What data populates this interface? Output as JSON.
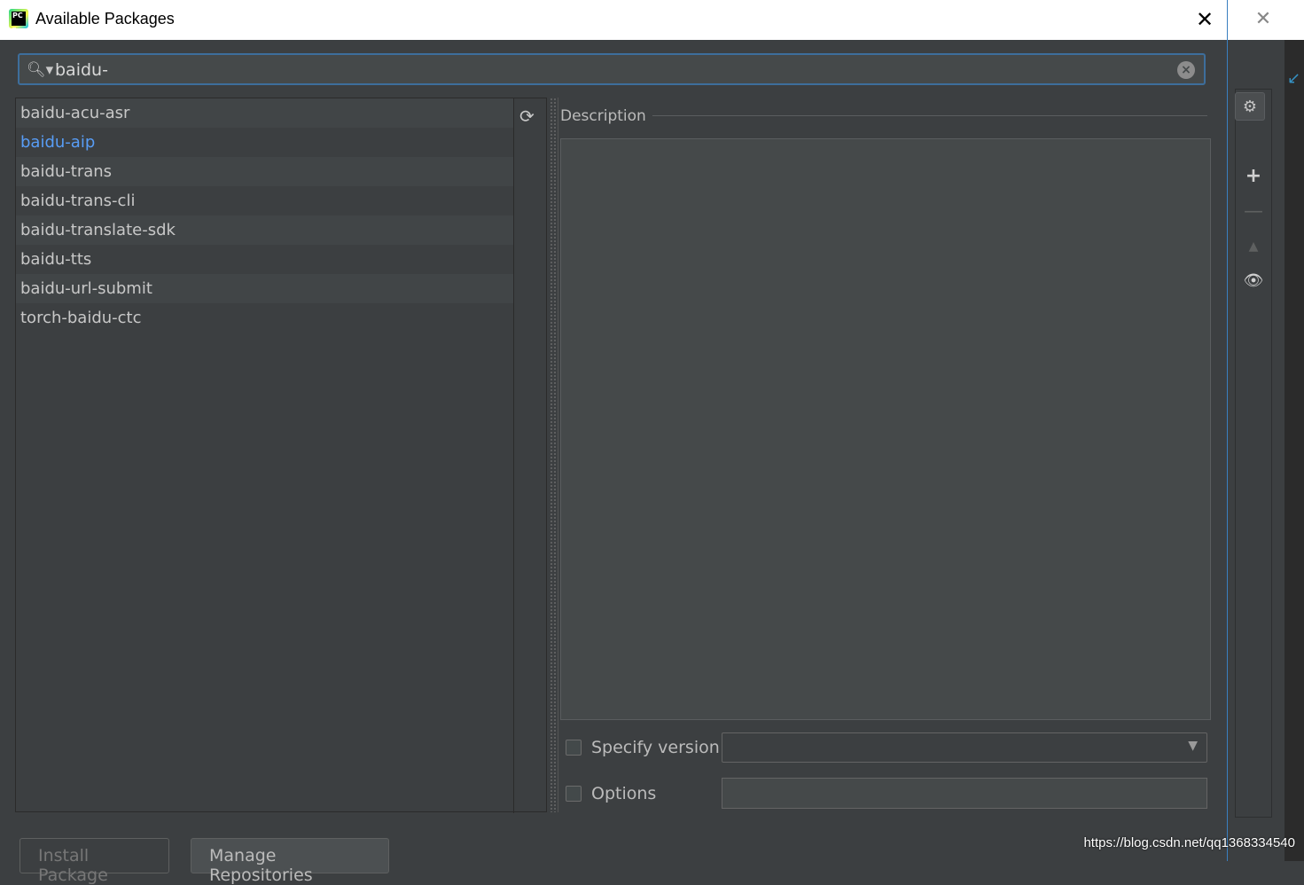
{
  "window": {
    "title": "Available Packages"
  },
  "search": {
    "value": "baidu-"
  },
  "packages": [
    {
      "name": "baidu-acu-asr",
      "selected": false
    },
    {
      "name": "baidu-aip",
      "selected": true
    },
    {
      "name": "baidu-trans",
      "selected": false
    },
    {
      "name": "baidu-trans-cli",
      "selected": false
    },
    {
      "name": "baidu-translate-sdk",
      "selected": false
    },
    {
      "name": "baidu-tts",
      "selected": false
    },
    {
      "name": "baidu-url-submit",
      "selected": false
    },
    {
      "name": "torch-baidu-ctc",
      "selected": false
    }
  ],
  "details": {
    "description_label": "Description",
    "specify_version_label": "Specify version",
    "options_label": "Options"
  },
  "buttons": {
    "install": "Install Package",
    "manage": "Manage Repositories"
  },
  "watermark": "https://blog.csdn.net/qq1368334540",
  "icons": {
    "app": "pycharm-icon",
    "search": "search-icon",
    "clear": "clear-icon",
    "refresh": "refresh-icon",
    "close": "close-icon"
  },
  "colors": {
    "selected_text": "#589df6",
    "focus_border": "#3d6e9c",
    "background": "#3c3f41"
  }
}
